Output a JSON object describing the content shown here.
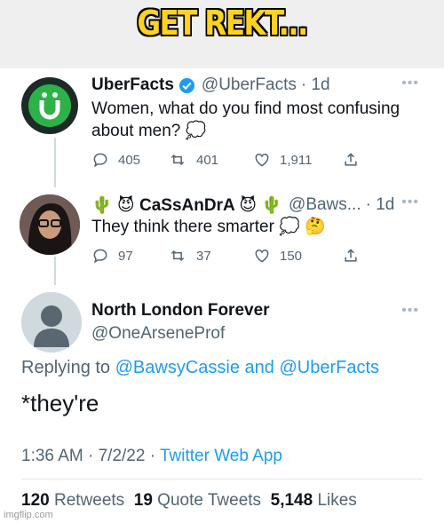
{
  "meme": {
    "title": "GET REKT..."
  },
  "tweets": [
    {
      "name": "UberFacts",
      "handle": "@UberFacts",
      "time": "· 1d",
      "text": "Women, what do you find most confusing about men? 💭",
      "replies": "405",
      "retweets": "401",
      "likes": "1,911"
    },
    {
      "name": "🌵 😈 CaSsAnDrA 😈 🌵",
      "handle": "@Baws...",
      "time": "· 1d",
      "text": "They think there smarter 💭 🤔",
      "replies": "97",
      "retweets": "37",
      "likes": "150"
    }
  ],
  "main_tweet": {
    "name": "North London Forever",
    "handle": "@OneArseneProf",
    "replying_prefix": "Replying to",
    "replying_user1": "@BawsyCassie",
    "replying_and": "and",
    "replying_user2": "@UberFacts",
    "text": "*they're",
    "time": "1:36 AM · 7/2/22 ·",
    "client": "Twitter Web App",
    "retweets_count": "120",
    "retweets_label": "Retweets",
    "quotes_count": "19",
    "quotes_label": "Quote Tweets",
    "likes_count": "5,148",
    "likes_label": "Likes"
  },
  "watermark": "imgflip.com",
  "colors": {
    "link": "#1d9bf0",
    "verified": "#1d9bf0",
    "meme_title": "#ffd21f",
    "uberfacts_green": "#2db24a"
  }
}
